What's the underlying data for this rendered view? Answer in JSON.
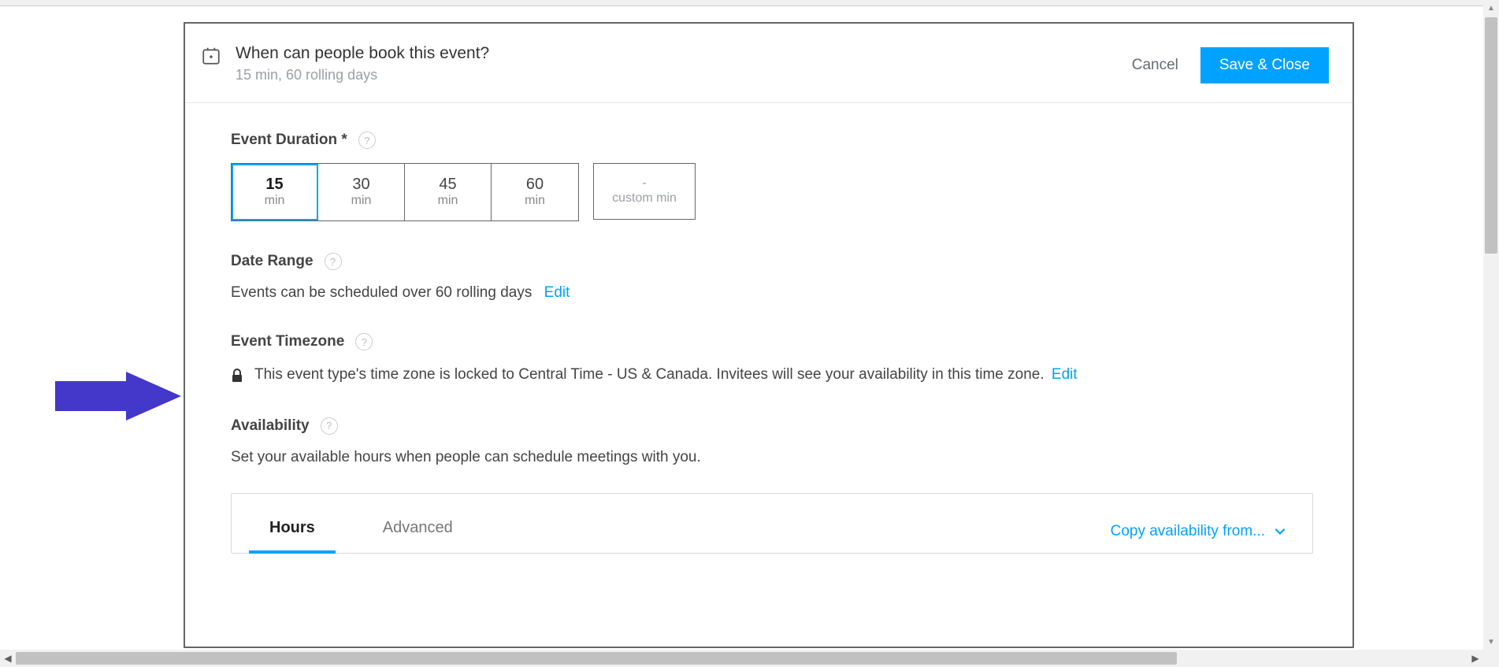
{
  "header": {
    "title": "When can people book this event?",
    "subtitle": "15 min, 60 rolling days",
    "cancel": "Cancel",
    "save": "Save & Close"
  },
  "duration": {
    "label": "Event Duration *",
    "options": [
      {
        "value": "15",
        "unit": "min",
        "selected": true
      },
      {
        "value": "30",
        "unit": "min",
        "selected": false
      },
      {
        "value": "45",
        "unit": "min",
        "selected": false
      },
      {
        "value": "60",
        "unit": "min",
        "selected": false
      }
    ],
    "custom": {
      "dash": "-",
      "label": "custom min"
    }
  },
  "dateRange": {
    "label": "Date Range",
    "text": "Events can be scheduled over 60 rolling days",
    "edit": "Edit"
  },
  "timezone": {
    "label": "Event Timezone",
    "text": "This event type's time zone is locked to Central Time - US & Canada. Invitees will see your availability in this time zone.",
    "edit": "Edit"
  },
  "availability": {
    "label": "Availability",
    "text": "Set your available hours when people can schedule meetings with you.",
    "tabs": {
      "hours": "Hours",
      "advanced": "Advanced"
    },
    "copy": "Copy availability from..."
  }
}
